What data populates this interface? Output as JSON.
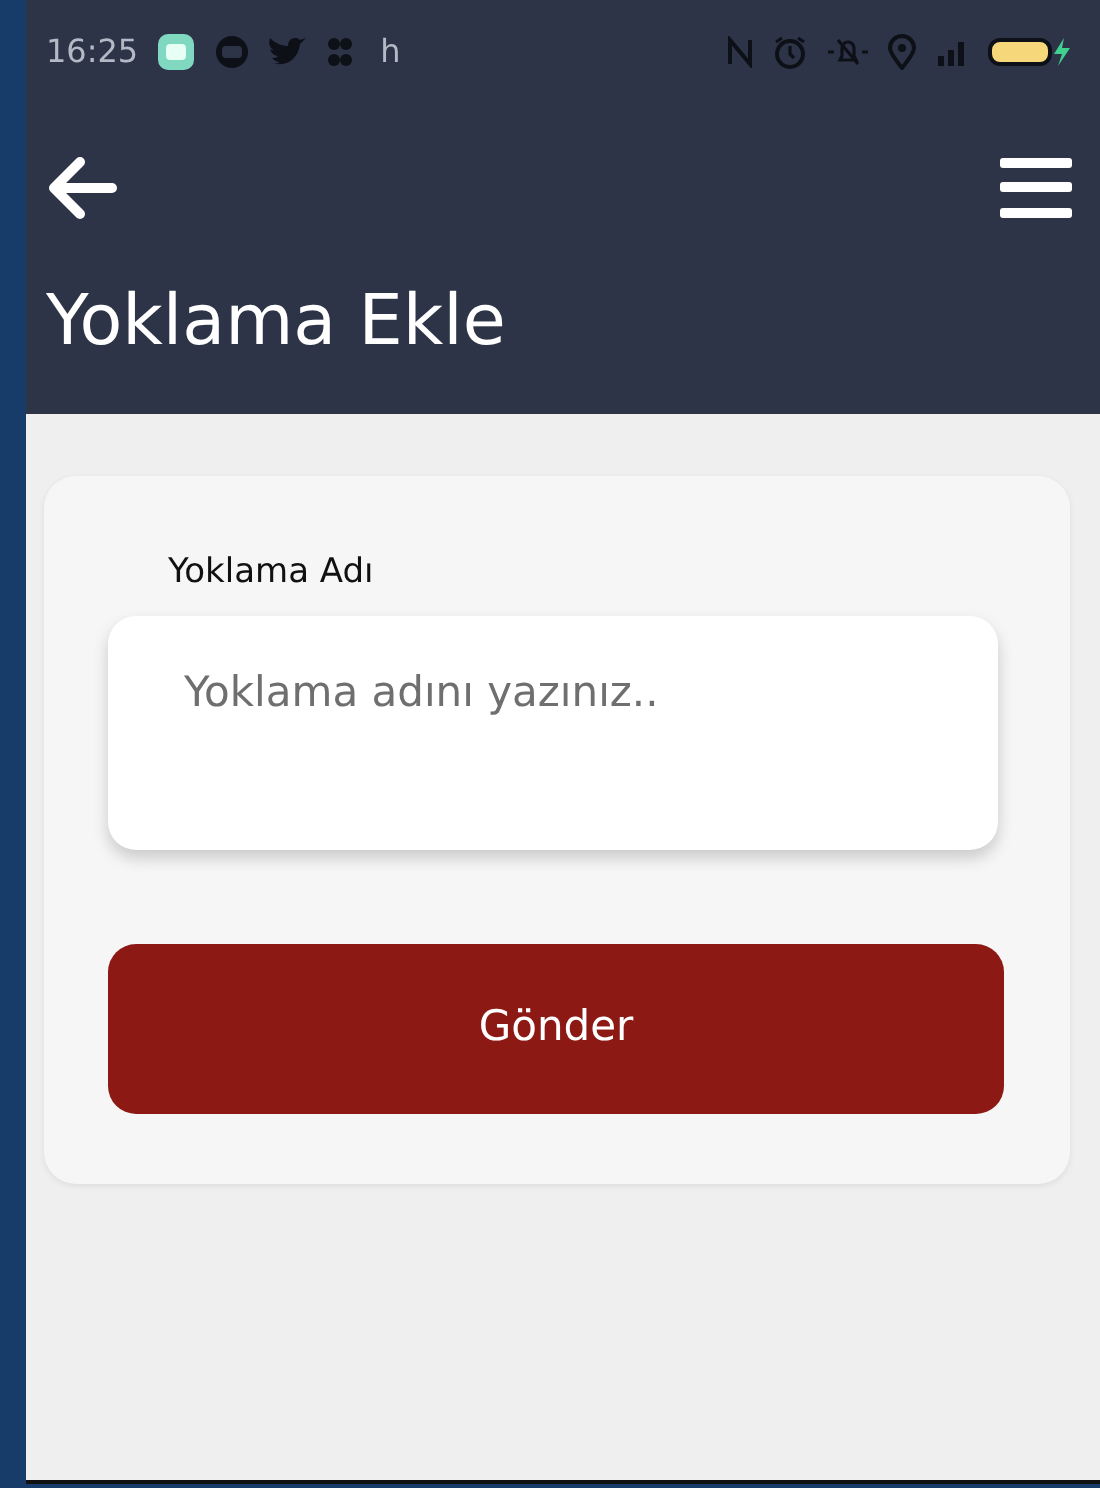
{
  "status_bar": {
    "time": "16:25",
    "app_letter": "h"
  },
  "header": {
    "title": "Yoklama Ekle"
  },
  "form": {
    "label": "Yoklama Adı",
    "placeholder": "Yoklama adını yazınız..",
    "submit": "Gönder"
  }
}
